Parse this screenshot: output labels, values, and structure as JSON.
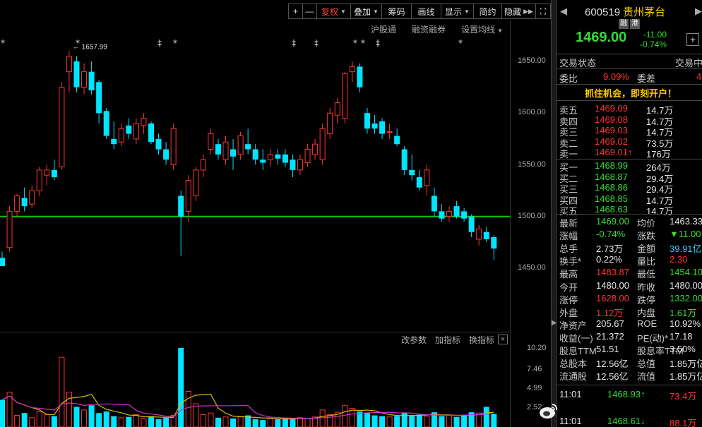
{
  "toolbar": {
    "plus": "+",
    "minus": "—",
    "fuquan": "复权",
    "diejia": "叠加",
    "choumа": "筹码",
    "huaxian": "画线",
    "xianshi": "显示",
    "jianyue": "简约",
    "yincang": "隐藏",
    "fullscreen": "⛶"
  },
  "subtoolbar": {
    "hgt": "沪股通",
    "rzrq": "融资融券",
    "settings": "设置均线"
  },
  "vol_toolbar": {
    "params": "改参数",
    "add": "加指标",
    "swap": "换指标",
    "close": "×"
  },
  "annotation": {
    "high_marker": "← 1657.99"
  },
  "price_axis": [
    "1650.00",
    "1600.00",
    "1550.00",
    "1500.00",
    "1450.00"
  ],
  "volume_axis": [
    "10.20",
    "7.46",
    "4.99",
    "2.52"
  ],
  "colors": {
    "up": "#ff3333",
    "down": "#00e5ff",
    "support_line": "#00cc00",
    "ma_yellow": "#d8c000",
    "ma_magenta": "#cc33cc"
  },
  "chart_data": {
    "type": "candlestick",
    "ylim": [
      1430,
      1680
    ],
    "support_level": 1500,
    "candles": [
      {
        "o": 1460,
        "h": 1466,
        "l": 1455,
        "c": 1452
      },
      {
        "o": 1470,
        "h": 1510,
        "l": 1466,
        "c": 1505
      },
      {
        "o": 1505,
        "h": 1522,
        "l": 1500,
        "c": 1520
      },
      {
        "o": 1518,
        "h": 1528,
        "l": 1505,
        "c": 1510
      },
      {
        "o": 1512,
        "h": 1530,
        "l": 1508,
        "c": 1525
      },
      {
        "o": 1525,
        "h": 1548,
        "l": 1520,
        "c": 1545
      },
      {
        "o": 1540,
        "h": 1550,
        "l": 1530,
        "c": 1545
      },
      {
        "o": 1545,
        "h": 1555,
        "l": 1535,
        "c": 1538
      },
      {
        "o": 1548,
        "h": 1630,
        "l": 1545,
        "c": 1625
      },
      {
        "o": 1640,
        "h": 1660,
        "l": 1620,
        "c": 1655
      },
      {
        "o": 1650,
        "h": 1655,
        "l": 1620,
        "c": 1625
      },
      {
        "o": 1625,
        "h": 1648,
        "l": 1618,
        "c": 1640
      },
      {
        "o": 1640,
        "h": 1650,
        "l": 1618,
        "c": 1622
      },
      {
        "o": 1630,
        "h": 1632,
        "l": 1590,
        "c": 1600
      },
      {
        "o": 1602,
        "h": 1605,
        "l": 1575,
        "c": 1578
      },
      {
        "o": 1575,
        "h": 1592,
        "l": 1565,
        "c": 1570
      },
      {
        "o": 1572,
        "h": 1590,
        "l": 1568,
        "c": 1585
      },
      {
        "o": 1588,
        "h": 1595,
        "l": 1575,
        "c": 1580
      },
      {
        "o": 1575,
        "h": 1595,
        "l": 1570,
        "c": 1590
      },
      {
        "o": 1588,
        "h": 1600,
        "l": 1580,
        "c": 1595
      },
      {
        "o": 1590,
        "h": 1592,
        "l": 1570,
        "c": 1572
      },
      {
        "o": 1575,
        "h": 1580,
        "l": 1560,
        "c": 1565
      },
      {
        "o": 1565,
        "h": 1572,
        "l": 1550,
        "c": 1555
      },
      {
        "o": 1550,
        "h": 1590,
        "l": 1545,
        "c": 1585
      },
      {
        "o": 1520,
        "h": 1525,
        "l": 1462,
        "c": 1500
      },
      {
        "o": 1505,
        "h": 1540,
        "l": 1495,
        "c": 1535
      },
      {
        "o": 1520,
        "h": 1548,
        "l": 1515,
        "c": 1545
      },
      {
        "o": 1545,
        "h": 1560,
        "l": 1538,
        "c": 1555
      },
      {
        "o": 1565,
        "h": 1585,
        "l": 1560,
        "c": 1580
      },
      {
        "o": 1570,
        "h": 1575,
        "l": 1555,
        "c": 1560
      },
      {
        "o": 1555,
        "h": 1578,
        "l": 1550,
        "c": 1572
      },
      {
        "o": 1565,
        "h": 1575,
        "l": 1545,
        "c": 1558
      },
      {
        "o": 1560,
        "h": 1582,
        "l": 1555,
        "c": 1578
      },
      {
        "o": 1570,
        "h": 1585,
        "l": 1560,
        "c": 1565
      },
      {
        "o": 1565,
        "h": 1570,
        "l": 1550,
        "c": 1555
      },
      {
        "o": 1555,
        "h": 1565,
        "l": 1545,
        "c": 1552
      },
      {
        "o": 1555,
        "h": 1565,
        "l": 1548,
        "c": 1560
      },
      {
        "o": 1560,
        "h": 1565,
        "l": 1550,
        "c": 1556
      },
      {
        "o": 1560,
        "h": 1565,
        "l": 1548,
        "c": 1552
      },
      {
        "o": 1555,
        "h": 1560,
        "l": 1538,
        "c": 1545
      },
      {
        "o": 1545,
        "h": 1560,
        "l": 1540,
        "c": 1555
      },
      {
        "o": 1552,
        "h": 1570,
        "l": 1548,
        "c": 1565
      },
      {
        "o": 1560,
        "h": 1575,
        "l": 1555,
        "c": 1570
      },
      {
        "o": 1555,
        "h": 1590,
        "l": 1550,
        "c": 1585
      },
      {
        "o": 1580,
        "h": 1605,
        "l": 1575,
        "c": 1600
      },
      {
        "o": 1598,
        "h": 1615,
        "l": 1590,
        "c": 1610
      },
      {
        "o": 1595,
        "h": 1640,
        "l": 1590,
        "c": 1638
      },
      {
        "o": 1640,
        "h": 1650,
        "l": 1630,
        "c": 1645
      },
      {
        "o": 1645,
        "h": 1648,
        "l": 1620,
        "c": 1625
      },
      {
        "o": 1600,
        "h": 1605,
        "l": 1580,
        "c": 1585
      },
      {
        "o": 1590,
        "h": 1598,
        "l": 1580,
        "c": 1585
      },
      {
        "o": 1592,
        "h": 1595,
        "l": 1575,
        "c": 1580
      },
      {
        "o": 1582,
        "h": 1590,
        "l": 1575,
        "c": 1582
      },
      {
        "o": 1578,
        "h": 1585,
        "l": 1568,
        "c": 1570
      },
      {
        "o": 1565,
        "h": 1568,
        "l": 1540,
        "c": 1545
      },
      {
        "o": 1545,
        "h": 1560,
        "l": 1535,
        "c": 1540
      },
      {
        "o": 1538,
        "h": 1545,
        "l": 1525,
        "c": 1528
      },
      {
        "o": 1530,
        "h": 1550,
        "l": 1520,
        "c": 1545
      },
      {
        "o": 1520,
        "h": 1528,
        "l": 1500,
        "c": 1505
      },
      {
        "o": 1505,
        "h": 1512,
        "l": 1495,
        "c": 1498
      },
      {
        "o": 1500,
        "h": 1510,
        "l": 1495,
        "c": 1505
      },
      {
        "o": 1510,
        "h": 1515,
        "l": 1498,
        "c": 1500
      },
      {
        "o": 1505,
        "h": 1508,
        "l": 1495,
        "c": 1498
      },
      {
        "o": 1500,
        "h": 1502,
        "l": 1480,
        "c": 1485
      },
      {
        "o": 1478,
        "h": 1492,
        "l": 1472,
        "c": 1488
      },
      {
        "o": 1485,
        "h": 1490,
        "l": 1475,
        "c": 1478
      },
      {
        "o": 1480,
        "h": 1482,
        "l": 1458,
        "c": 1469
      }
    ],
    "volume_ylim": [
      0,
      10.2
    ],
    "volume": [
      3.5,
      4.5,
      1.5,
      1.8,
      1.2,
      2.0,
      1.6,
      1.4,
      9.0,
      4.5,
      2.6,
      2.2,
      2.8,
      1.8,
      2.0,
      1.4,
      1.2,
      1.3,
      1.6,
      1.1,
      1.4,
      1.0,
      1.2,
      1.5,
      10.2,
      4.6,
      3.0,
      1.6,
      1.8,
      1.2,
      1.3,
      1.1,
      1.3,
      1.5,
      1.0,
      0.9,
      1.1,
      1.0,
      1.2,
      1.0,
      1.2,
      1.1,
      1.3,
      2.2,
      1.6,
      1.9,
      2.8,
      2.4,
      2.0,
      1.8,
      1.5,
      1.4,
      1.3,
      1.4,
      1.8,
      1.5,
      1.6,
      1.4,
      1.9,
      1.4,
      1.5,
      1.3,
      1.5,
      1.9,
      1.8,
      2.6,
      1.7
    ]
  },
  "quote": {
    "nav_prev": "◀",
    "nav_next": "▶",
    "code": "600519",
    "name": "贵州茅台",
    "tag_rong": "融",
    "tag_gang": "港",
    "price": "1469.00",
    "change": "-11.00",
    "change_pct": "-0.74%",
    "add_btn": "+",
    "status_label": "交易状态",
    "status_value": "交易中",
    "weibi_label": "委比",
    "weibi_value": "9.09%",
    "weicha_label": "委差",
    "weicha_value": "4",
    "promo": "抓住机会，即刻开户！",
    "asks": [
      {
        "label": "卖五",
        "price": "1469.09",
        "vol": "14.7万"
      },
      {
        "label": "卖四",
        "price": "1469.08",
        "vol": "14.7万"
      },
      {
        "label": "卖三",
        "price": "1469.03",
        "vol": "14.7万"
      },
      {
        "label": "卖二",
        "price": "1469.02",
        "vol": "73.5万"
      },
      {
        "label": "卖一",
        "price": "1469.01↑",
        "vol": "176万"
      }
    ],
    "bids": [
      {
        "label": "买一",
        "price": "1468.99",
        "vol": "264万"
      },
      {
        "label": "买二",
        "price": "1468.87",
        "vol": "29.4万"
      },
      {
        "label": "买三",
        "price": "1468.86",
        "vol": "29.4万"
      },
      {
        "label": "买四",
        "price": "1468.85",
        "vol": "14.7万"
      },
      {
        "label": "买五",
        "price": "1468.63",
        "vol": "14.7万"
      }
    ],
    "stats": [
      {
        "l1": "最新",
        "v1": "1469.00",
        "l2": "均价",
        "v2": "1463.33"
      },
      {
        "l1": "涨幅",
        "v1": "-0.74%",
        "l2": "涨跌",
        "v2": "▼11.00"
      },
      {
        "l1": "总手",
        "v1": "2.73万",
        "l2": "金额",
        "v2": "39.91亿"
      },
      {
        "l1": "换手*",
        "v1": "0.22%",
        "l2": "量比",
        "v2": "2.30"
      },
      {
        "l1": "最高",
        "v1": "1483.87",
        "l2": "最低",
        "v2": "1454.10"
      },
      {
        "l1": "今开",
        "v1": "1480.00",
        "l2": "昨收",
        "v2": "1480.00"
      },
      {
        "l1": "涨停",
        "v1": "1628.00",
        "l2": "跌停",
        "v2": "1332.00"
      },
      {
        "l1": "外盘",
        "v1": "1.12万",
        "l2": "内盘",
        "v2": "1.61万"
      },
      {
        "l1": "净资产",
        "v1": "205.67",
        "l2": "ROE",
        "v2": "10.92%"
      },
      {
        "l1": "收益(一)",
        "v1": "21.372",
        "l2": "PE(动)*",
        "v2": "17.18"
      },
      {
        "l1": "股息TTM",
        "v1": "51.51",
        "l2": "股息率TTM",
        "v2": "3.50%"
      },
      {
        "l1": "总股本",
        "v1": "12.56亿",
        "l2": "总值",
        "v2": "1.85万亿"
      },
      {
        "l1": "流通股",
        "v1": "12.56亿",
        "l2": "流值",
        "v2": "1.85万亿"
      }
    ],
    "ticks": [
      {
        "time": "11:01",
        "price": "1468.93↑",
        "vol": "73.4万"
      },
      {
        "time": "11:01",
        "price": "1468.61↓",
        "vol": "88.1万"
      }
    ]
  }
}
